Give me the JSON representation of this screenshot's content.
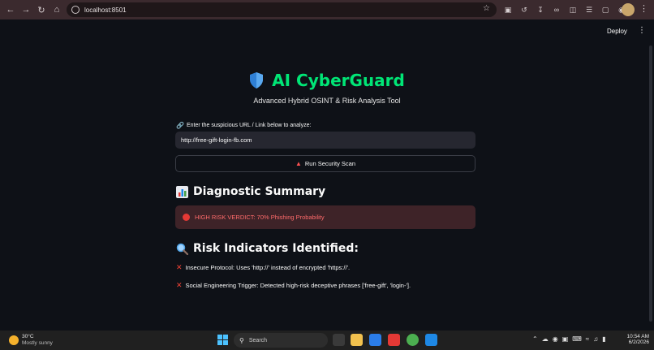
{
  "browser": {
    "url": "localhost:8501",
    "icons": [
      "back-icon",
      "forward-icon",
      "reload-icon",
      "home-icon",
      "star-icon",
      "extensions-icon",
      "menu-icon"
    ]
  },
  "app_header": {
    "deploy_label": "Deploy",
    "menu_glyph": "⋮"
  },
  "main": {
    "title": "AI CyberGuard",
    "subtitle": "Advanced Hybrid OSINT & Risk Analysis Tool",
    "input_label": "Enter the suspicious URL / Link below to analyze:",
    "input_value": "http://free-gift-login-fb.com",
    "scan_button_label": "Run Security Scan",
    "diagnostic_heading": "Diagnostic Summary",
    "verdict": "HIGH RISK VERDICT: 70% Phishing Probability",
    "indicators_heading": "Risk Indicators Identified:",
    "indicators": [
      "Insecure Protocol: Uses 'http://' instead of encrypted 'https://'.",
      "Social Engineering Trigger: Detected high-risk deceptive phrases ['free-gift', 'login-']."
    ]
  },
  "taskbar": {
    "weather_temp": "30°C",
    "weather_condition": "Mostly sunny",
    "search_placeholder": "Search",
    "time": "10:54 AM",
    "date": "6/2/2026"
  },
  "colors": {
    "title": "#00e676",
    "background": "#0e1117",
    "alert_bg": "#3e2328",
    "alert_text": "#ff6b6b",
    "error_mark": "#f44336"
  }
}
